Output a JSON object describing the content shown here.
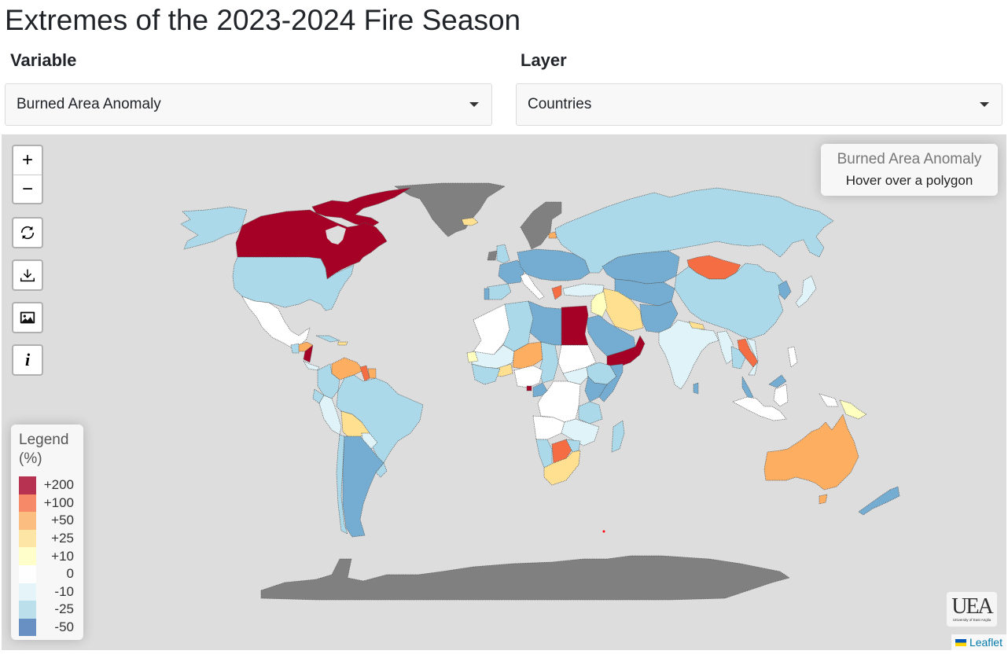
{
  "page": {
    "title": "Extremes of the 2023-2024 Fire Season"
  },
  "controls": {
    "variable": {
      "label": "Variable",
      "selected": "Burned Area Anomaly"
    },
    "layer": {
      "label": "Layer",
      "selected": "Countries"
    }
  },
  "map": {
    "zoom_in_label": "+",
    "zoom_out_label": "−",
    "buttons": [
      {
        "name": "reset-view",
        "icon": "refresh-icon"
      },
      {
        "name": "download",
        "icon": "download-icon"
      },
      {
        "name": "save-image",
        "icon": "image-icon"
      },
      {
        "name": "info",
        "icon": "info-icon",
        "label": "i"
      }
    ],
    "info_box": {
      "title": "Burned Area Anomaly",
      "subtitle": "Hover over a polygon"
    },
    "legend": {
      "title": "Legend (%)",
      "items": [
        {
          "label": "+200",
          "color": "#a50026"
        },
        {
          "label": "+100",
          "color": "#f46d43"
        },
        {
          "label": "+50",
          "color": "#fdae61"
        },
        {
          "label": "+25",
          "color": "#fee090"
        },
        {
          "label": "+10",
          "color": "#ffffbf"
        },
        {
          "label": "0",
          "color": "#ffffff"
        },
        {
          "label": "-10",
          "color": "#e0f3f8"
        },
        {
          "label": "-25",
          "color": "#abd9e9"
        },
        {
          "label": "-50",
          "color": "#4575b4"
        }
      ]
    },
    "logo": {
      "mark": "UEA",
      "text": "University of East Anglia"
    },
    "attribution": {
      "label": "Leaflet"
    },
    "colors": {
      "background": "#dddddd",
      "no_data": "#808080",
      "c200": "#a50026",
      "c100": "#f46d43",
      "c50": "#fdae61",
      "c25": "#fee090",
      "c10": "#ffffbf",
      "c0": "#ffffff",
      "cm10": "#e0f3f8",
      "cm25": "#abd9e9",
      "cm50": "#74add1"
    },
    "regions": [
      {
        "name": "Canada",
        "class": "+200"
      },
      {
        "name": "Greenland",
        "class": "no-data"
      },
      {
        "name": "Alaska / United States",
        "class": "-25"
      },
      {
        "name": "Mexico",
        "class": "0"
      },
      {
        "name": "Nicaragua",
        "class": "+200"
      },
      {
        "name": "Honduras",
        "class": "+50"
      },
      {
        "name": "Venezuela",
        "class": "+50"
      },
      {
        "name": "Guyana",
        "class": "+100"
      },
      {
        "name": "Brazil",
        "class": "-25"
      },
      {
        "name": "Bolivia",
        "class": "+25"
      },
      {
        "name": "Argentina",
        "class": "-50"
      },
      {
        "name": "Peru",
        "class": "-10"
      },
      {
        "name": "Russia",
        "class": "-25"
      },
      {
        "name": "Mongolia",
        "class": "+100"
      },
      {
        "name": "China",
        "class": "-25"
      },
      {
        "name": "India",
        "class": "-10"
      },
      {
        "name": "Iran",
        "class": "+25"
      },
      {
        "name": "Egypt",
        "class": "+200"
      },
      {
        "name": "Yemen / Oman",
        "class": "+200"
      },
      {
        "name": "Saudi Arabia",
        "class": "-50"
      },
      {
        "name": "Niger",
        "class": "+50"
      },
      {
        "name": "Botswana",
        "class": "+100"
      },
      {
        "name": "South Africa",
        "class": "+25"
      },
      {
        "name": "Australia",
        "class": "+50"
      },
      {
        "name": "New Zealand",
        "class": "-50"
      },
      {
        "name": "Laos",
        "class": "+100"
      },
      {
        "name": "Papua New Guinea",
        "class": "+10"
      },
      {
        "name": "Antarctica",
        "class": "no-data"
      },
      {
        "name": "Scandinavia",
        "class": "no-data"
      }
    ]
  }
}
